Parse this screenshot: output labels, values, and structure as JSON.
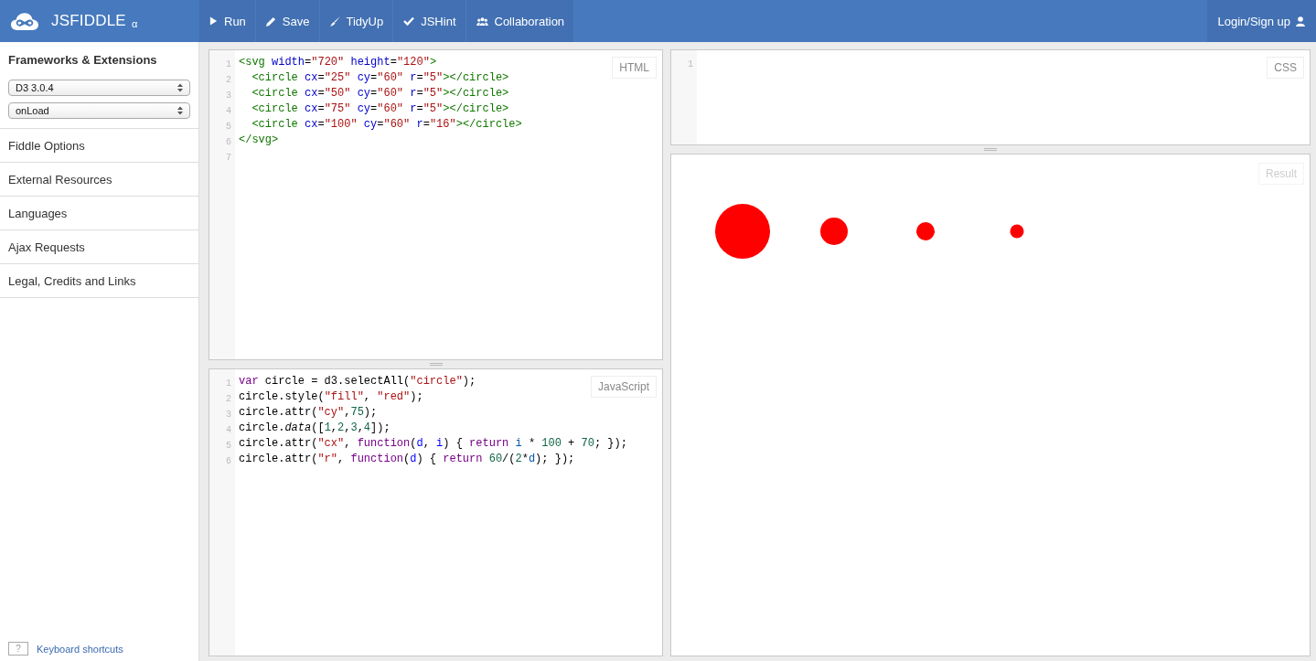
{
  "brand": {
    "name": "JSFIDDLE",
    "badge": "α"
  },
  "toolbar": [
    {
      "label": "Run",
      "kind": "run"
    },
    {
      "label": "Save",
      "kind": "save"
    },
    {
      "label": "TidyUp",
      "kind": "tidy"
    },
    {
      "label": "JSHint",
      "kind": "check"
    },
    {
      "label": "Collaboration",
      "kind": "people"
    }
  ],
  "account": {
    "label": "Login/Sign up"
  },
  "sidebar": {
    "heading": "Frameworks & Extensions",
    "selects": [
      {
        "value": "D3 3.0.4"
      },
      {
        "value": "onLoad"
      }
    ],
    "items": [
      "Fiddle Options",
      "External Resources",
      "Languages",
      "Ajax Requests",
      "Legal, Credits and Links"
    ],
    "shortcut_key": "?",
    "shortcut_link": "Keyboard shortcuts"
  },
  "html_pane": {
    "label": "HTML",
    "lines": [
      {
        "number": "1",
        "tokens": [
          {
            "text": "<svg",
            "kind": "tag"
          },
          {
            "text": " width",
            "kind": "attr"
          },
          {
            "text": "=",
            "kind": "plain"
          },
          {
            "text": "\"720\"",
            "kind": "string"
          },
          {
            "text": " height",
            "kind": "attr"
          },
          {
            "text": "=",
            "kind": "plain"
          },
          {
            "text": "\"120\"",
            "kind": "string"
          },
          {
            "text": ">",
            "kind": "tag"
          }
        ]
      },
      {
        "number": "2",
        "tokens": [
          {
            "text": "  <circle",
            "kind": "tag"
          },
          {
            "text": " cx",
            "kind": "attr"
          },
          {
            "text": "=",
            "kind": "plain"
          },
          {
            "text": "\"25\"",
            "kind": "string"
          },
          {
            "text": " cy",
            "kind": "attr"
          },
          {
            "text": "=",
            "kind": "plain"
          },
          {
            "text": "\"60\"",
            "kind": "string"
          },
          {
            "text": " r",
            "kind": "attr"
          },
          {
            "text": "=",
            "kind": "plain"
          },
          {
            "text": "\"5\"",
            "kind": "string"
          },
          {
            "text": "></circle>",
            "kind": "tag"
          }
        ]
      },
      {
        "number": "3",
        "tokens": [
          {
            "text": "  <circle",
            "kind": "tag"
          },
          {
            "text": " cx",
            "kind": "attr"
          },
          {
            "text": "=",
            "kind": "plain"
          },
          {
            "text": "\"50\"",
            "kind": "string"
          },
          {
            "text": " cy",
            "kind": "attr"
          },
          {
            "text": "=",
            "kind": "plain"
          },
          {
            "text": "\"60\"",
            "kind": "string"
          },
          {
            "text": " r",
            "kind": "attr"
          },
          {
            "text": "=",
            "kind": "plain"
          },
          {
            "text": "\"5\"",
            "kind": "string"
          },
          {
            "text": "></circle>",
            "kind": "tag"
          }
        ]
      },
      {
        "number": "4",
        "tokens": [
          {
            "text": "  <circle",
            "kind": "tag"
          },
          {
            "text": " cx",
            "kind": "attr"
          },
          {
            "text": "=",
            "kind": "plain"
          },
          {
            "text": "\"75\"",
            "kind": "string"
          },
          {
            "text": " cy",
            "kind": "attr"
          },
          {
            "text": "=",
            "kind": "plain"
          },
          {
            "text": "\"60\"",
            "kind": "string"
          },
          {
            "text": " r",
            "kind": "attr"
          },
          {
            "text": "=",
            "kind": "plain"
          },
          {
            "text": "\"5\"",
            "kind": "string"
          },
          {
            "text": "></circle>",
            "kind": "tag"
          }
        ]
      },
      {
        "number": "5",
        "tokens": [
          {
            "text": "  <circle",
            "kind": "tag"
          },
          {
            "text": " cx",
            "kind": "attr"
          },
          {
            "text": "=",
            "kind": "plain"
          },
          {
            "text": "\"100\"",
            "kind": "string"
          },
          {
            "text": " cy",
            "kind": "attr"
          },
          {
            "text": "=",
            "kind": "plain"
          },
          {
            "text": "\"60\"",
            "kind": "string"
          },
          {
            "text": " r",
            "kind": "attr"
          },
          {
            "text": "=",
            "kind": "plain"
          },
          {
            "text": "\"16\"",
            "kind": "string"
          },
          {
            "text": "></circle>",
            "kind": "tag"
          }
        ]
      },
      {
        "number": "6",
        "tokens": [
          {
            "text": "</svg>",
            "kind": "tag"
          }
        ]
      },
      {
        "number": "7"
      }
    ]
  },
  "js_pane": {
    "label": "JavaScript",
    "lines": [
      {
        "number": "1",
        "tokens": [
          {
            "text": "var",
            "kind": "keyword"
          },
          {
            "text": " circle = d3.selectAll(",
            "kind": "plain"
          },
          {
            "text": "\"circle\"",
            "kind": "string"
          },
          {
            "text": ");",
            "kind": "plain"
          }
        ]
      },
      {
        "number": "2",
        "tokens": [
          {
            "text": "circle.style(",
            "kind": "plain"
          },
          {
            "text": "\"fill\"",
            "kind": "string"
          },
          {
            "text": ", ",
            "kind": "plain"
          },
          {
            "text": "\"red\"",
            "kind": "string"
          },
          {
            "text": ");",
            "kind": "plain"
          }
        ]
      },
      {
        "number": "3",
        "tokens": [
          {
            "text": "circle.attr(",
            "kind": "plain"
          },
          {
            "text": "\"cy\"",
            "kind": "string"
          },
          {
            "text": ",",
            "kind": "plain"
          },
          {
            "text": "75",
            "kind": "number"
          },
          {
            "text": ");",
            "kind": "plain"
          }
        ]
      },
      {
        "number": "4",
        "tokens": [
          {
            "text": "circle.",
            "kind": "plain"
          },
          {
            "text": "data",
            "kind": "property"
          },
          {
            "text": "([",
            "kind": "plain"
          },
          {
            "text": "1",
            "kind": "number"
          },
          {
            "text": ",",
            "kind": "plain"
          },
          {
            "text": "2",
            "kind": "number"
          },
          {
            "text": ",",
            "kind": "plain"
          },
          {
            "text": "3",
            "kind": "number"
          },
          {
            "text": ",",
            "kind": "plain"
          },
          {
            "text": "4",
            "kind": "number"
          },
          {
            "text": "]);",
            "kind": "plain"
          }
        ]
      },
      {
        "number": "5",
        "tokens": [
          {
            "text": "circle.attr(",
            "kind": "plain"
          },
          {
            "text": "\"cx\"",
            "kind": "string"
          },
          {
            "text": ", ",
            "kind": "plain"
          },
          {
            "text": "function",
            "kind": "keyword"
          },
          {
            "text": "(",
            "kind": "plain"
          },
          {
            "text": "d",
            "kind": "def"
          },
          {
            "text": ", ",
            "kind": "plain"
          },
          {
            "text": "i",
            "kind": "def"
          },
          {
            "text": ") { ",
            "kind": "plain"
          },
          {
            "text": "return",
            "kind": "keyword"
          },
          {
            "text": " i",
            "kind": "variable"
          },
          {
            "text": " * ",
            "kind": "plain"
          },
          {
            "text": "100",
            "kind": "number"
          },
          {
            "text": " + ",
            "kind": "plain"
          },
          {
            "text": "70",
            "kind": "number"
          },
          {
            "text": "; });",
            "kind": "plain"
          }
        ]
      },
      {
        "number": "6",
        "tokens": [
          {
            "text": "circle.attr(",
            "kind": "plain"
          },
          {
            "text": "\"r\"",
            "kind": "string"
          },
          {
            "text": ", ",
            "kind": "plain"
          },
          {
            "text": "function",
            "kind": "keyword"
          },
          {
            "text": "(",
            "kind": "plain"
          },
          {
            "text": "d",
            "kind": "def"
          },
          {
            "text": ") { ",
            "kind": "plain"
          },
          {
            "text": "return",
            "kind": "keyword"
          },
          {
            "text": " 60",
            "kind": "number"
          },
          {
            "text": "/(",
            "kind": "plain"
          },
          {
            "text": "2",
            "kind": "number"
          },
          {
            "text": "*",
            "kind": "plain"
          },
          {
            "text": "d",
            "kind": "variable"
          },
          {
            "text": "); });",
            "kind": "plain"
          }
        ]
      }
    ]
  },
  "css_pane": {
    "label": "CSS",
    "lines": [
      {
        "number": "1"
      }
    ]
  },
  "result_pane": {
    "label": "Result"
  }
}
